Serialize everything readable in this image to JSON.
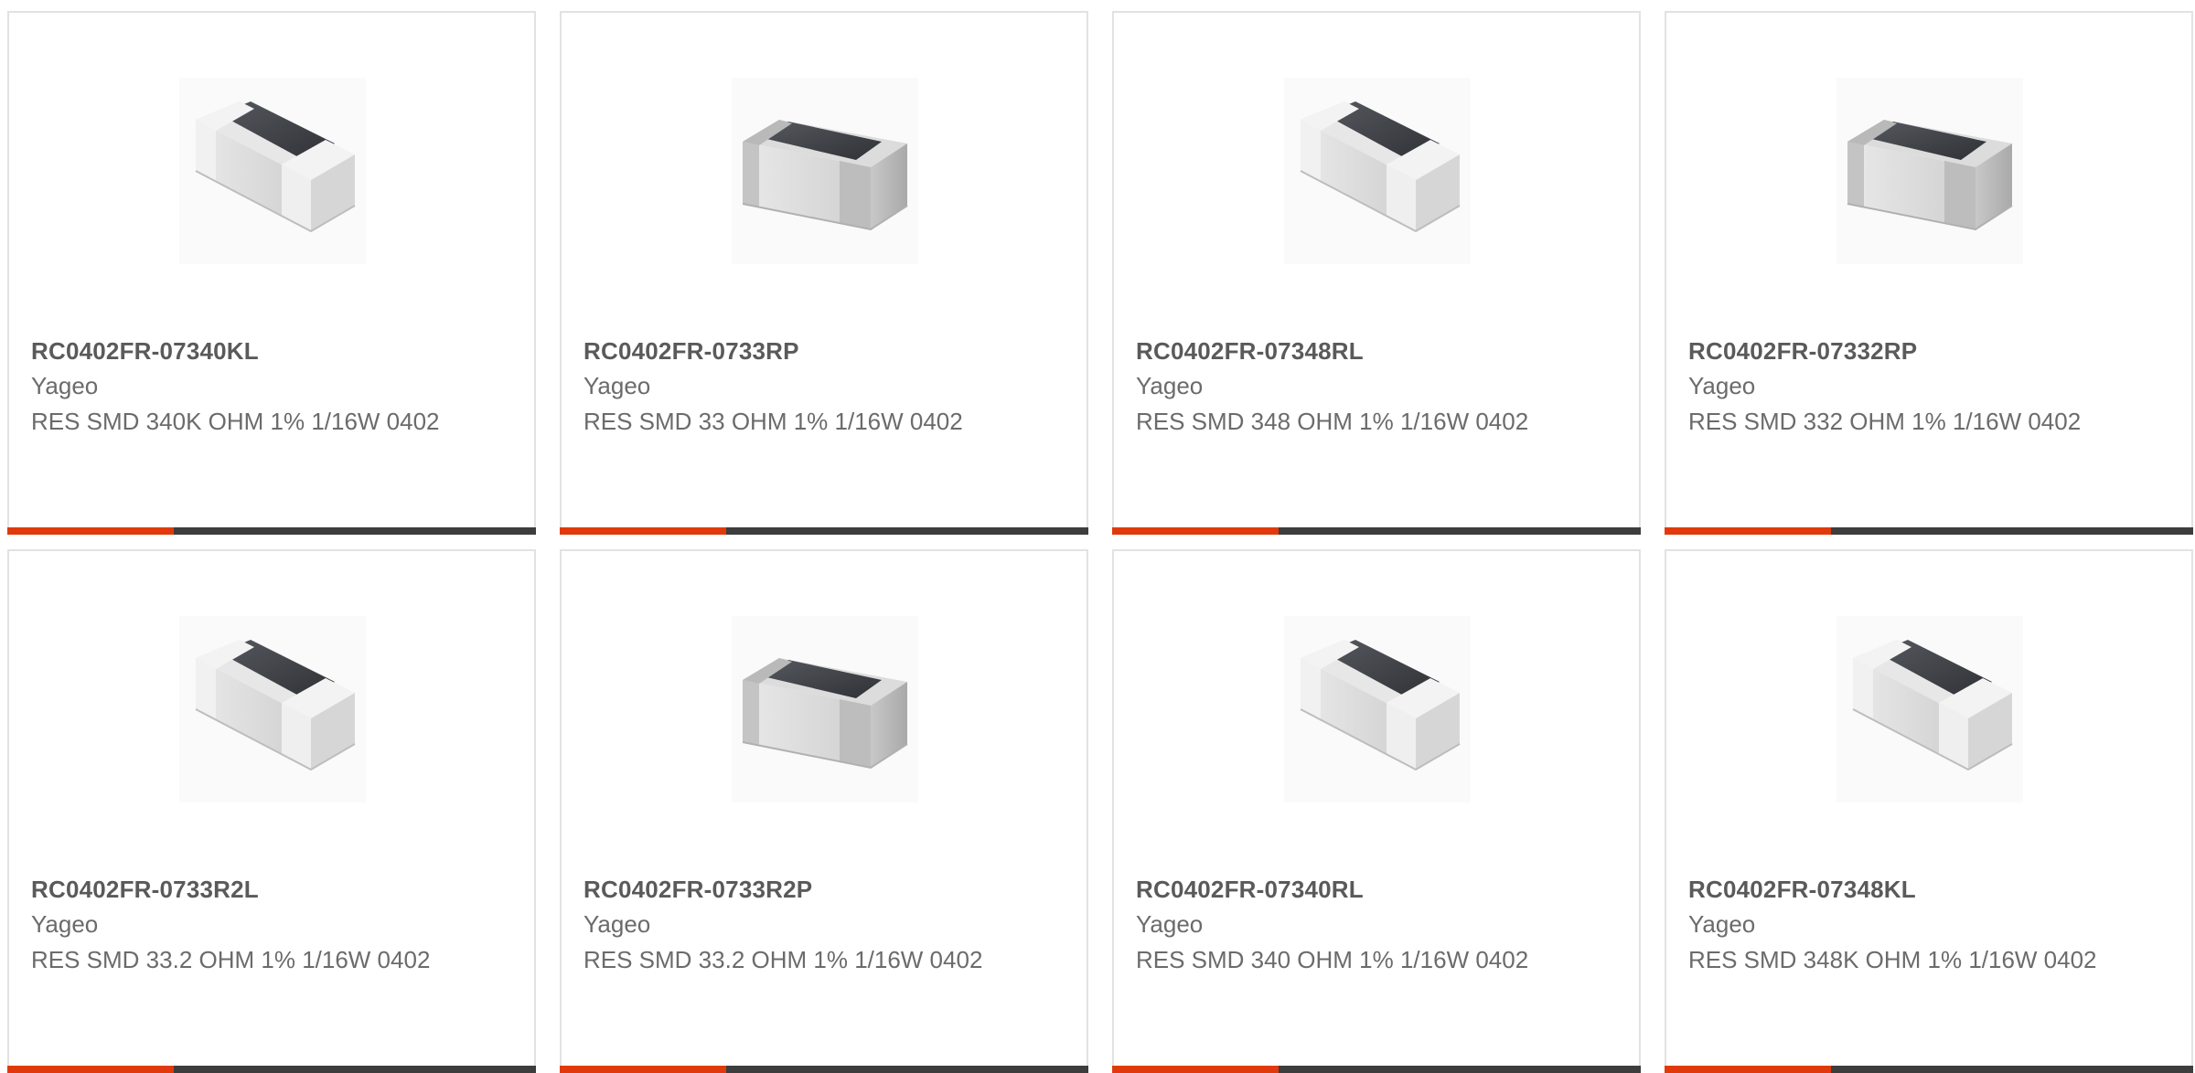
{
  "colors": {
    "accent": "#e03a0c",
    "bar": "#3d3d3d",
    "border": "#e2e2e2"
  },
  "products": [
    {
      "part_number": "RC0402FR-07340KL",
      "manufacturer": "Yageo",
      "description": "RES SMD 340K OHM 1% 1/16W 0402",
      "image": "resistor-chip-image"
    },
    {
      "part_number": "RC0402FR-0733RP",
      "manufacturer": "Yageo",
      "description": "RES SMD 33 OHM 1% 1/16W 0402",
      "image": "resistor-chip-image"
    },
    {
      "part_number": "RC0402FR-07348RL",
      "manufacturer": "Yageo",
      "description": "RES SMD 348 OHM 1% 1/16W 0402",
      "image": "resistor-chip-image"
    },
    {
      "part_number": "RC0402FR-07332RP",
      "manufacturer": "Yageo",
      "description": "RES SMD 332 OHM 1% 1/16W 0402",
      "image": "resistor-chip-image"
    },
    {
      "part_number": "RC0402FR-0733R2L",
      "manufacturer": "Yageo",
      "description": "RES SMD 33.2 OHM 1% 1/16W 0402",
      "image": "resistor-chip-image"
    },
    {
      "part_number": "RC0402FR-0733R2P",
      "manufacturer": "Yageo",
      "description": "RES SMD 33.2 OHM 1% 1/16W 0402",
      "image": "resistor-chip-image"
    },
    {
      "part_number": "RC0402FR-07340RL",
      "manufacturer": "Yageo",
      "description": "RES SMD 340 OHM 1% 1/16W 0402",
      "image": "resistor-chip-image"
    },
    {
      "part_number": "RC0402FR-07348KL",
      "manufacturer": "Yageo",
      "description": "RES SMD 348K OHM 1% 1/16W 0402",
      "image": "resistor-chip-image"
    }
  ]
}
